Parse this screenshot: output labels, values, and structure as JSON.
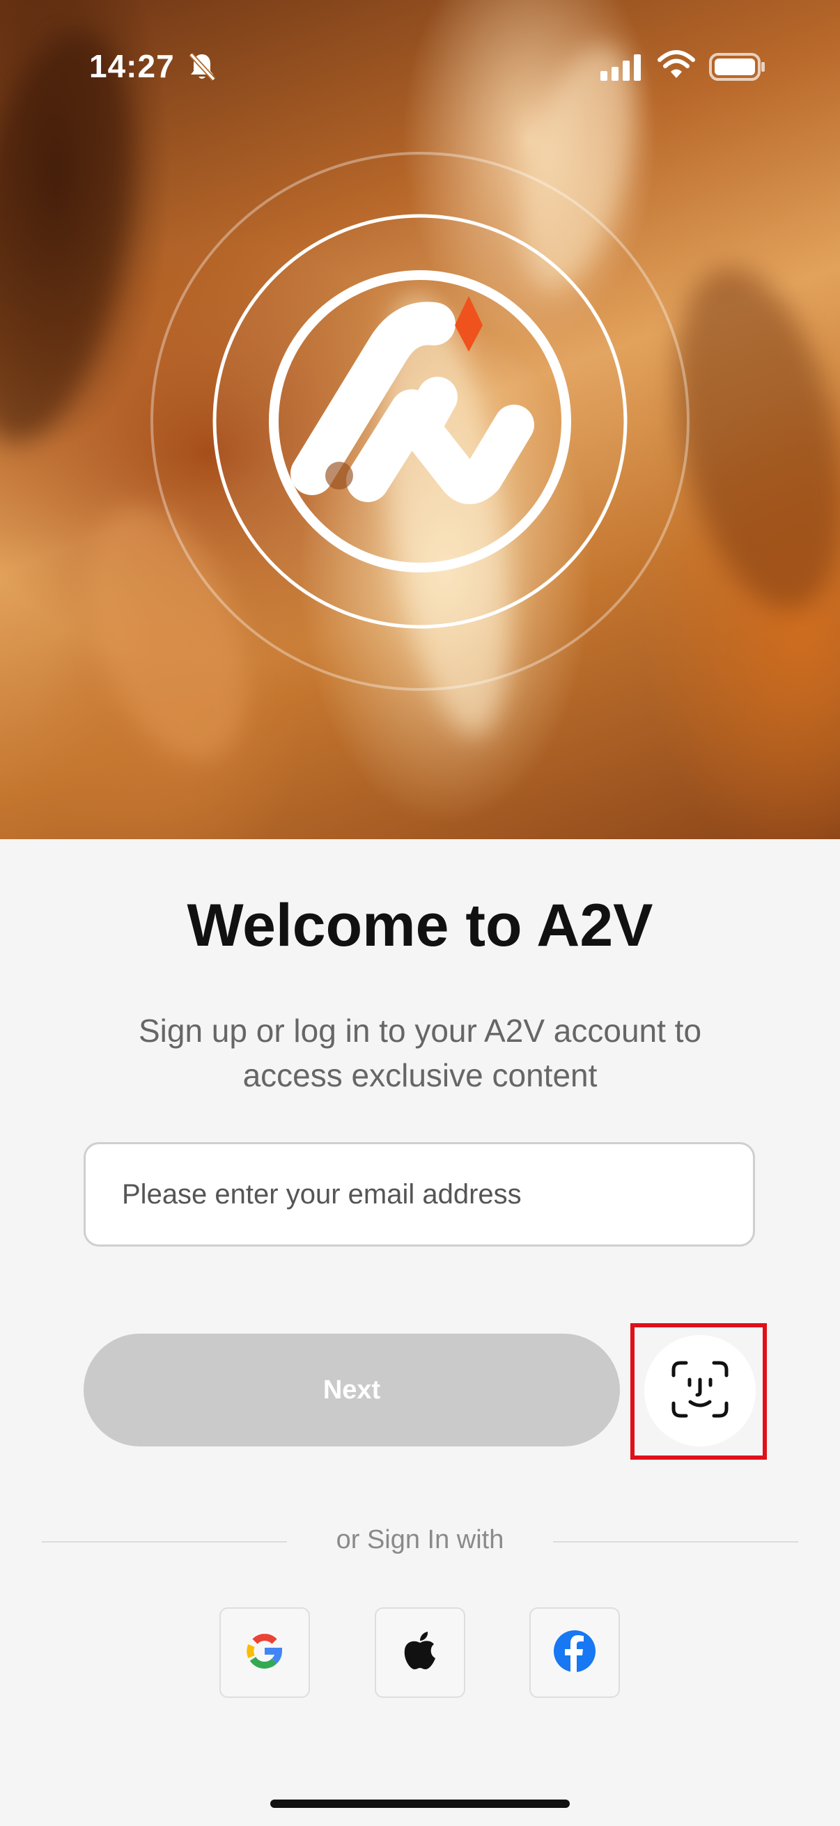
{
  "status_bar": {
    "time": "14:27",
    "icons": [
      "bell-slash-icon",
      "signal-icon",
      "wifi-icon",
      "battery-icon"
    ]
  },
  "hero": {
    "logo": "a2v-logo",
    "accent_color": "#f0521d"
  },
  "welcome": {
    "title": "Welcome to A2V",
    "subtitle_line1": "Sign up or log in to your A2V account to",
    "subtitle_line2": "access exclusive content"
  },
  "form": {
    "email_placeholder": "Please enter your email address",
    "email_value": "",
    "next_label": "Next",
    "next_color": "#cacaca",
    "faceid_icon": "face-id-icon",
    "highlight_color": "#e0101a"
  },
  "social": {
    "divider_text": "or Sign In with",
    "providers": [
      "google-icon",
      "apple-icon",
      "facebook-icon"
    ]
  }
}
